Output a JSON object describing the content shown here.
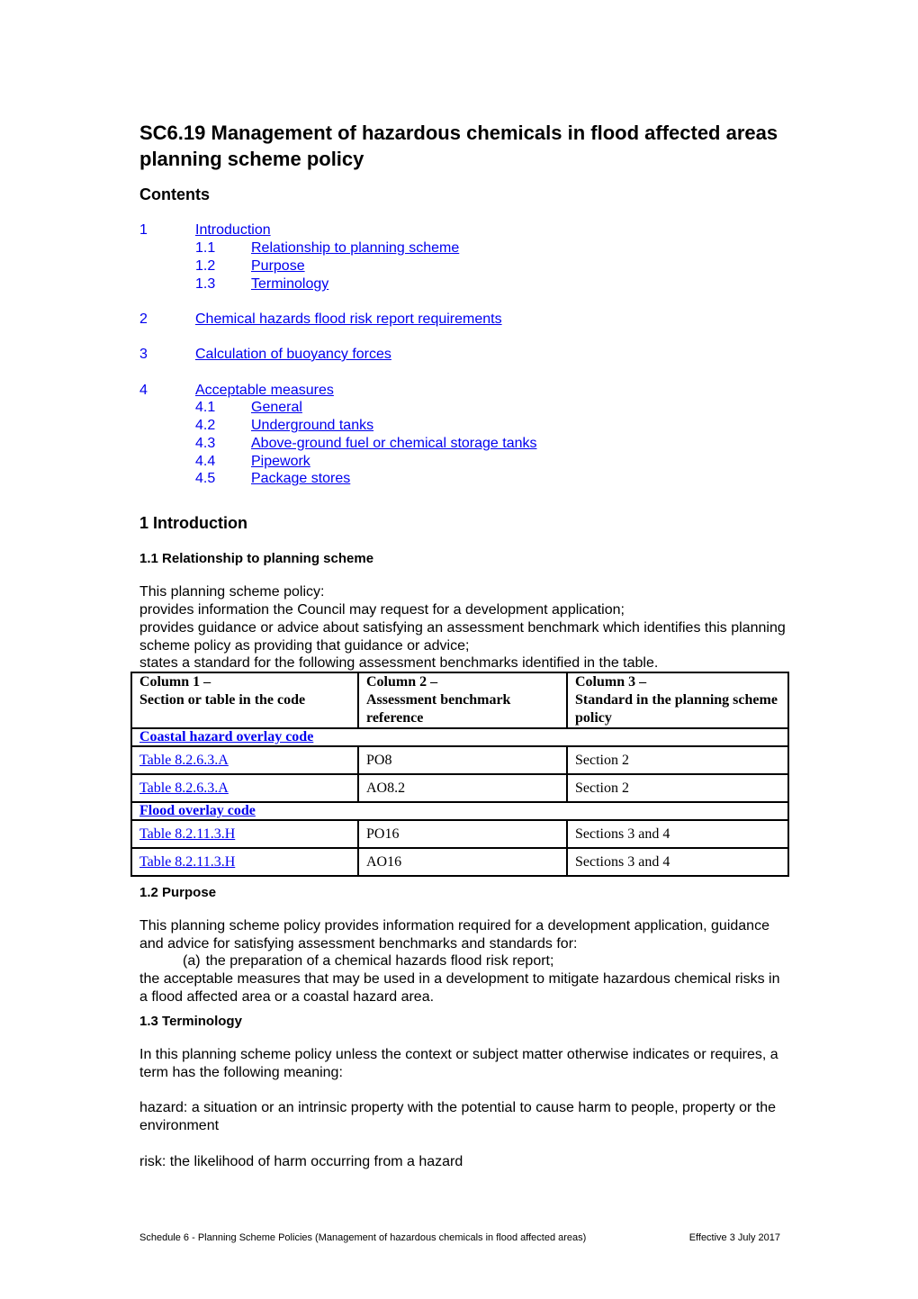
{
  "document": {
    "title": "SC6.19 Management of hazardous chemicals in flood affected areas planning scheme policy",
    "contents_heading": "Contents",
    "toc": [
      {
        "num": "1",
        "label": "Introduction",
        "level": 1
      },
      {
        "num": "1.1",
        "label": "Relationship to planning scheme",
        "level": 2
      },
      {
        "num": "1.2",
        "label": "Purpose",
        "level": 2
      },
      {
        "num": "1.3",
        "label": "Terminology",
        "level": 2
      },
      {
        "num": "2",
        "label": "Chemical hazards flood risk report requirements",
        "level": 1
      },
      {
        "num": "3",
        "label": "Calculation of buoyancy forces",
        "level": 1
      },
      {
        "num": "4",
        "label": "Acceptable measures",
        "level": 1
      },
      {
        "num": "4.1",
        "label": "General",
        "level": 2
      },
      {
        "num": "4.2",
        "label": "Underground tanks",
        "level": 2
      },
      {
        "num": "4.3",
        "label": "Above-ground fuel or chemical storage tanks",
        "level": 2
      },
      {
        "num": "4.4",
        "label": "Pipework",
        "level": 2
      },
      {
        "num": "4.5",
        "label": "Package stores",
        "level": 2
      }
    ],
    "section1": {
      "heading": "1 Introduction",
      "sub1_heading": "1.1 Relationship to planning scheme",
      "sub1_lines": [
        "This planning scheme policy:",
        "provides information the Council may request for a development application;",
        "provides guidance or advice about satisfying an assessment benchmark which identifies this planning scheme policy as providing that guidance or advice;",
        "states a standard for the following assessment benchmarks identified in the table."
      ],
      "table": {
        "headers": [
          [
            "Column 1 –",
            "Section or table in the code"
          ],
          [
            "Column 2 –",
            "Assessment benchmark reference"
          ],
          [
            "Column 3 –",
            "Standard in the planning scheme policy"
          ]
        ],
        "groups": [
          {
            "name": "Coastal hazard overlay code",
            "rows": [
              [
                "Table 8.2.6.3.A",
                "PO8",
                "Section 2"
              ],
              [
                "Table 8.2.6.3.A",
                "AO8.2",
                "Section 2"
              ]
            ]
          },
          {
            "name": "Flood overlay code",
            "rows": [
              [
                "Table 8.2.11.3.H",
                "PO16",
                "Sections 3 and 4"
              ],
              [
                "Table 8.2.11.3.H",
                "AO16",
                "Sections 3 and 4"
              ]
            ]
          }
        ]
      },
      "sub2_heading": "1.2 Purpose",
      "sub2_intro": "This planning scheme policy provides information required for a development application, guidance and advice for satisfying assessment benchmarks and standards for:",
      "sub2_item_a_marker": "(a)",
      "sub2_item_a": "the preparation of a chemical hazards flood risk report;",
      "sub2_tail": "the acceptable measures that may be used in a development to mitigate hazardous chemical risks in a flood affected area or a coastal hazard area.",
      "sub3_heading": "1.3 Terminology",
      "sub3_intro": "In this planning scheme policy unless the context or subject matter otherwise indicates or requires, a term has the following meaning:",
      "def_hazard": "hazard: a situation or an intrinsic property with the potential to cause harm to people, property or the environment",
      "def_risk": "risk: the likelihood of harm occurring from a hazard"
    },
    "footer": {
      "left": "Schedule 6 - Planning Scheme Policies (Management of hazardous chemicals in flood affected areas)",
      "right": "Effective 3 July 2017"
    },
    "colors": {
      "link": "#0000ee",
      "text": "#000000"
    }
  }
}
